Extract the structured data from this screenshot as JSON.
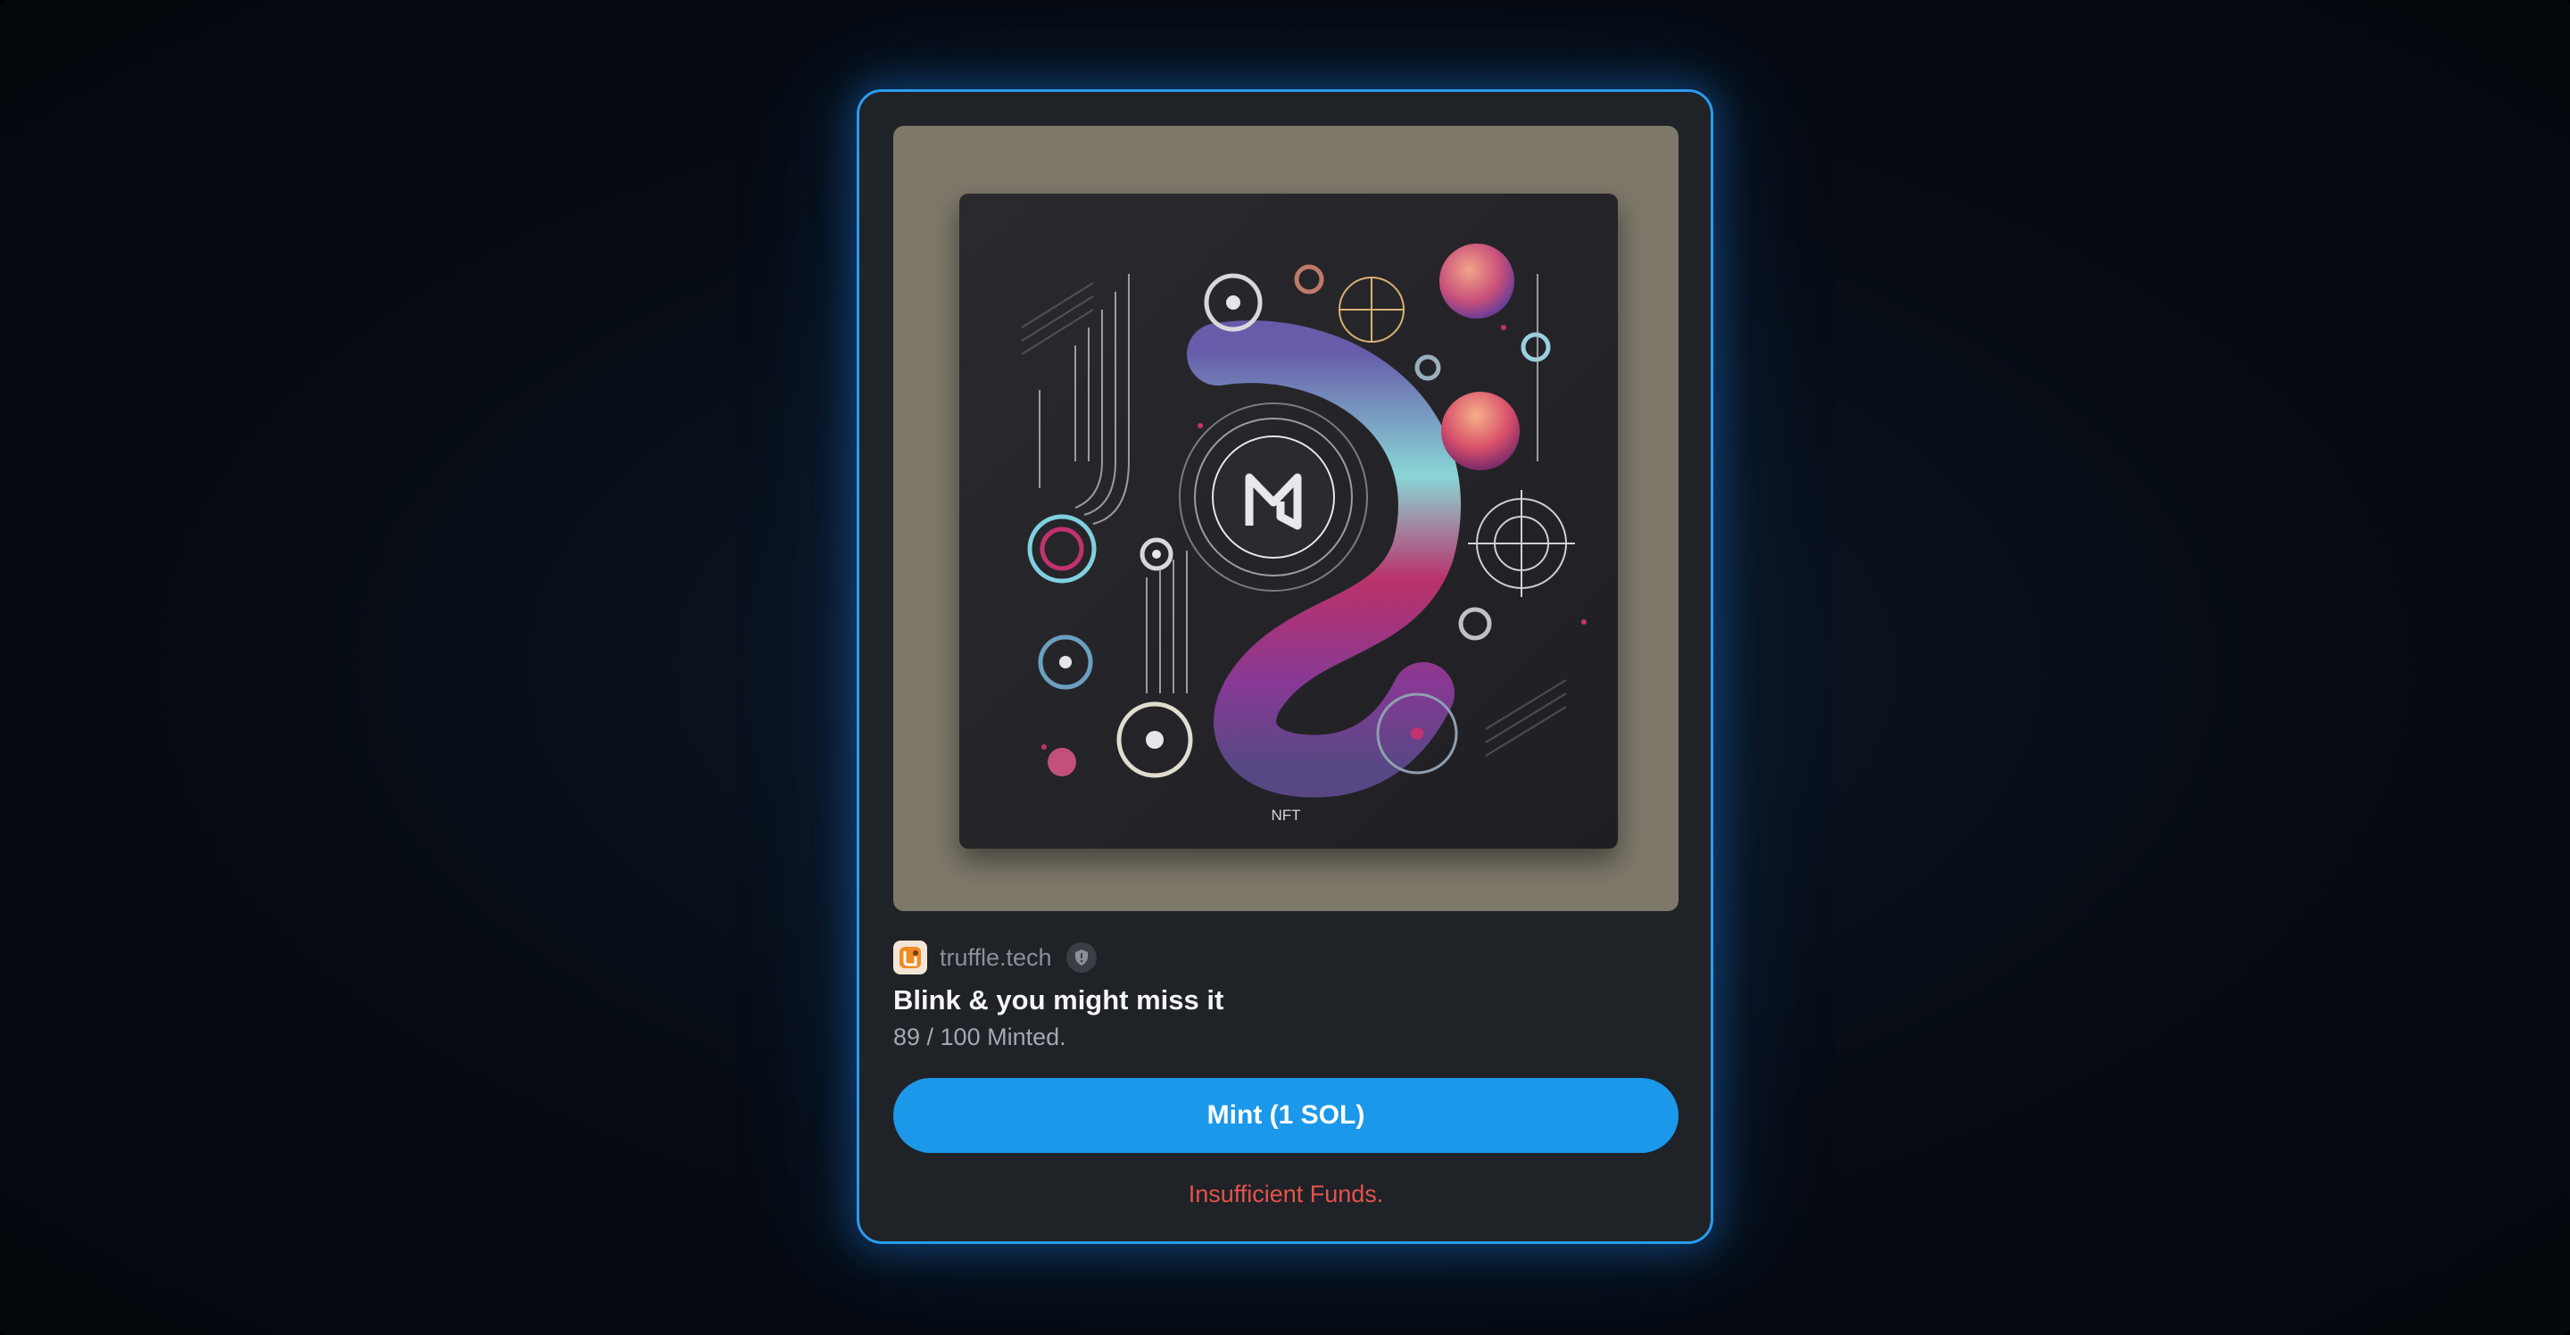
{
  "action": {
    "source": {
      "domain": "truffle.tech",
      "logo_icon": "truffle-logo-icon",
      "verified_icon": "shield-icon"
    },
    "image": {
      "icon": "nft-artwork",
      "caption": "NFT"
    },
    "title": "Blink & you might miss it",
    "description": "89 / 100 Minted.",
    "mint_button_label": "Mint (1 SOL)",
    "error_message": "Insufficient Funds."
  },
  "colors": {
    "accent": "#1b98ea",
    "card_border": "#2a9bf0",
    "error": "#e5534b",
    "card_background": "#1f2227",
    "image_frame": "#7d786a"
  }
}
